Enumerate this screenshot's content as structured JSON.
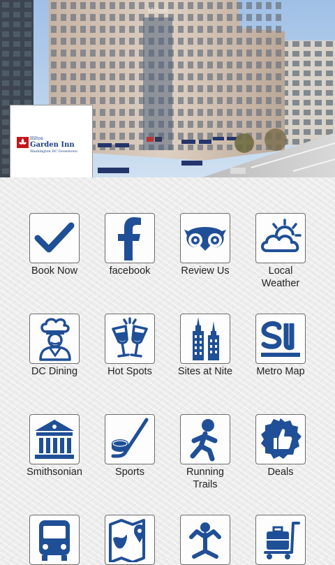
{
  "hero": {
    "brand_line1": "Hilton",
    "brand_line2": "Garden Inn",
    "brand_line3": "Washington DC Downtown",
    "building_sign": "Hilton"
  },
  "colors": {
    "icon_blue": "#1f4f96",
    "label": "#222222"
  },
  "tiles": [
    {
      "label": "Book Now",
      "icon": "checkmark-icon"
    },
    {
      "label": "facebook",
      "icon": "facebook-icon"
    },
    {
      "label": "Review Us",
      "icon": "tripadvisor-owl-icon"
    },
    {
      "label": "Local\nWeather",
      "icon": "sun-cloud-icon"
    },
    {
      "label": "DC Dining",
      "icon": "chef-icon"
    },
    {
      "label": "Hot Spots",
      "icon": "champagne-glasses-icon"
    },
    {
      "label": "Sites at Nite",
      "icon": "skyscrapers-icon"
    },
    {
      "label": "Metro Map",
      "icon": "stumbleupon-icon"
    },
    {
      "label": "Smithsonian",
      "icon": "museum-icon"
    },
    {
      "label": "Sports",
      "icon": "hockey-stick-icon"
    },
    {
      "label": "Running\nTrails",
      "icon": "runner-icon"
    },
    {
      "label": "Deals",
      "icon": "thumbs-up-badge-icon"
    },
    {
      "label": "",
      "icon": "bus-icon"
    },
    {
      "label": "",
      "icon": "map-pin-icon"
    },
    {
      "label": "",
      "icon": "yoga-icon"
    },
    {
      "label": "",
      "icon": "luggage-cart-icon"
    }
  ]
}
